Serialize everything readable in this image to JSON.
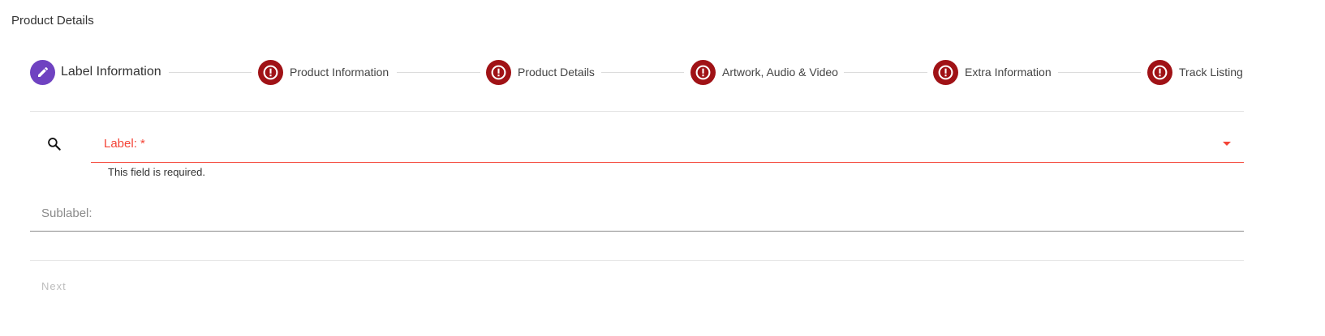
{
  "page": {
    "title": "Product Details"
  },
  "stepper": {
    "steps": [
      {
        "label": "Label Information",
        "state": "editing",
        "icon": "pencil-icon"
      },
      {
        "label": "Product Information",
        "state": "error",
        "icon": "error-icon"
      },
      {
        "label": "Product Details",
        "state": "error",
        "icon": "error-icon"
      },
      {
        "label": "Artwork, Audio & Video",
        "state": "error",
        "icon": "error-icon"
      },
      {
        "label": "Extra Information",
        "state": "error",
        "icon": "error-icon"
      },
      {
        "label": "Track Listing",
        "state": "error",
        "icon": "error-icon"
      }
    ]
  },
  "form": {
    "label_field": {
      "label": "Label: *",
      "helper": "This field is required.",
      "icon": "search-icon",
      "state": "error"
    },
    "sublabel_field": {
      "placeholder": "Sublabel:",
      "value": ""
    }
  },
  "actions": {
    "next_label": "Next",
    "next_disabled": true
  },
  "colors": {
    "accent": "#6f42c1",
    "error_step": "#a01216",
    "error_text": "#f44336"
  }
}
